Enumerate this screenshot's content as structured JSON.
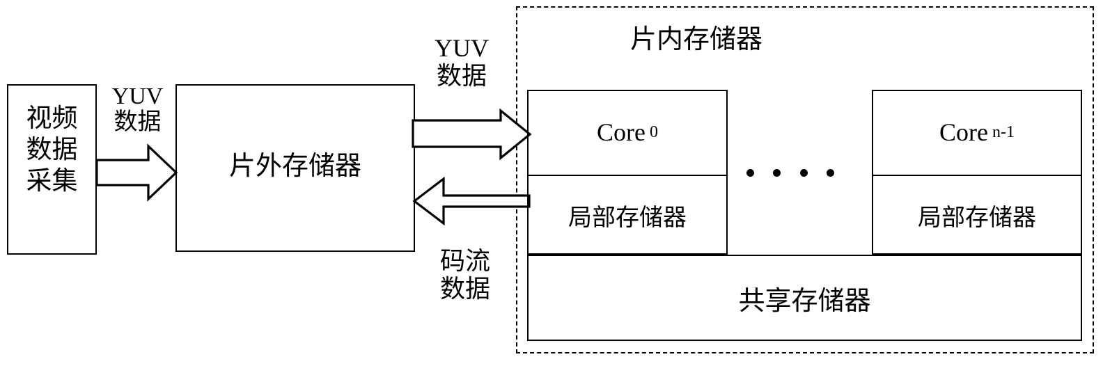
{
  "diagram": {
    "title_onchip": "片内存储器",
    "blocks": {
      "video_capture": "视频\n数据\n采集",
      "offchip_memory": "片外存储器",
      "shared_memory": "共享存储器"
    },
    "cores": [
      {
        "name_prefix": "Core",
        "index": "0",
        "local_memory": "局部存储器"
      },
      {
        "name_prefix": "Core",
        "index": "n-1",
        "local_memory": "局部存储器"
      }
    ],
    "ellipsis_dots": 4,
    "arrows": [
      {
        "id": "capture-to-offchip",
        "label_latin": "YUV",
        "label_cn": "数据",
        "direction": "right"
      },
      {
        "id": "offchip-to-onchip",
        "label_latin": "YUV",
        "label_cn": "数据",
        "direction": "right"
      },
      {
        "id": "onchip-to-offchip",
        "label_latin": "",
        "label_cn": "码流\n数据",
        "direction": "left"
      }
    ],
    "colors": {
      "stroke": "#000000",
      "background": "#ffffff"
    }
  }
}
